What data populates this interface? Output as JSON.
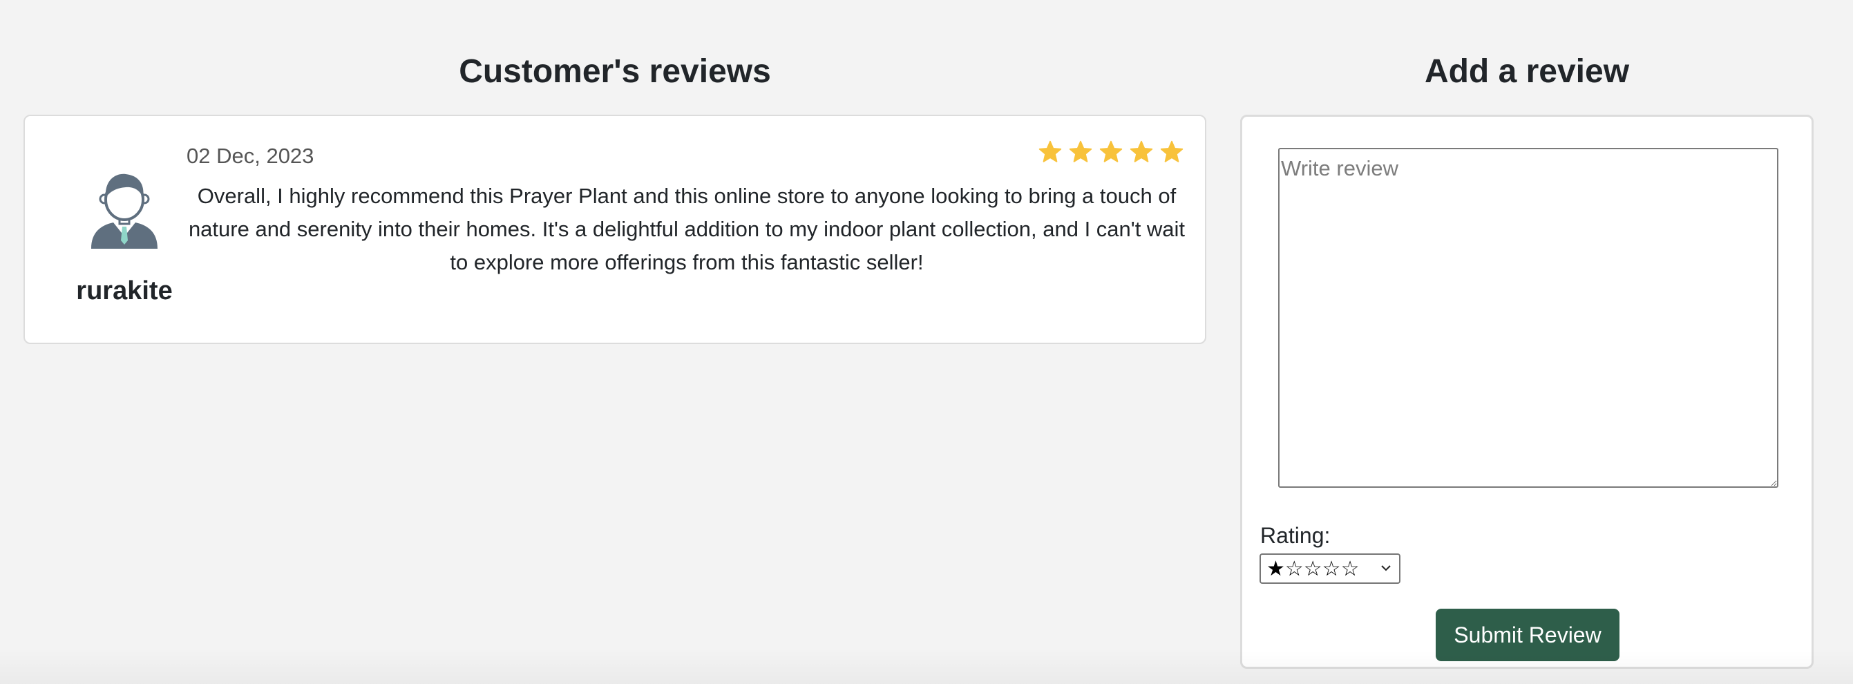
{
  "reviews_section": {
    "title": "Customer's reviews",
    "review": {
      "username": "rurakite",
      "date": "02 Dec, 2023",
      "rating_stars": 5,
      "star_color": "#f8c23b",
      "text": "Overall, I highly recommend this Prayer Plant and this online store to anyone looking to bring a touch of nature and serenity into their homes. It's a delightful addition to my indoor plant collection, and I can't wait to explore more offerings from this fantastic seller!",
      "avatar_icon": "user-avatar-icon"
    }
  },
  "add_review_section": {
    "title": "Add a review",
    "textarea_placeholder": "Write review",
    "textarea_value": "",
    "rating_label": "Rating:",
    "rating_selected": "★☆☆☆☆",
    "submit_label": "Submit Review",
    "button_color": "#2e5e4a"
  }
}
